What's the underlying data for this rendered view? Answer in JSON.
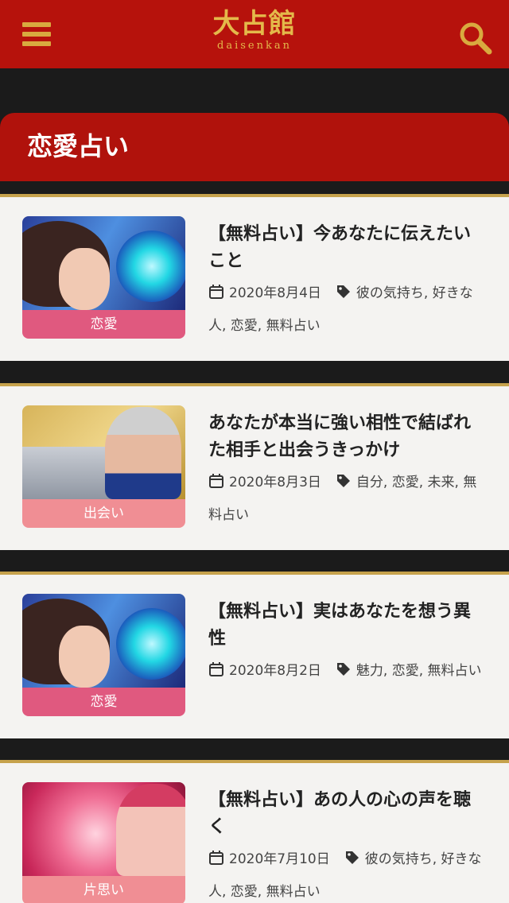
{
  "header": {
    "logo_main": "大占館",
    "logo_sub": "daisenkan"
  },
  "category": {
    "title": "恋愛占い"
  },
  "colors": {
    "header_bg": "#b6120c",
    "accent_gold": "#d9aa3f",
    "label_pink_dark": "#e0597f",
    "label_pink_light": "#f08e94"
  },
  "posts": [
    {
      "title": "【無料占い】今あなたに伝えたいこと",
      "date": "2020年8月4日",
      "tags": "彼の気持ち, 好きな人, 恋愛, 無料占い",
      "label": "恋愛"
    },
    {
      "title": "あなたが本当に強い相性で結ばれた相手と出会うきっかけ",
      "date": "2020年8月3日",
      "tags": "自分, 恋愛, 未来, 無料占い",
      "label": "出会い"
    },
    {
      "title": "【無料占い】実はあなたを想う異性",
      "date": "2020年8月2日",
      "tags": "魅力, 恋愛, 無料占い",
      "label": "恋愛"
    },
    {
      "title": "【無料占い】あの人の心の声を聴く",
      "date": "2020年7月10日",
      "tags": "彼の気持ち, 好きな人, 恋愛, 無料占い",
      "label": "片思い"
    }
  ]
}
